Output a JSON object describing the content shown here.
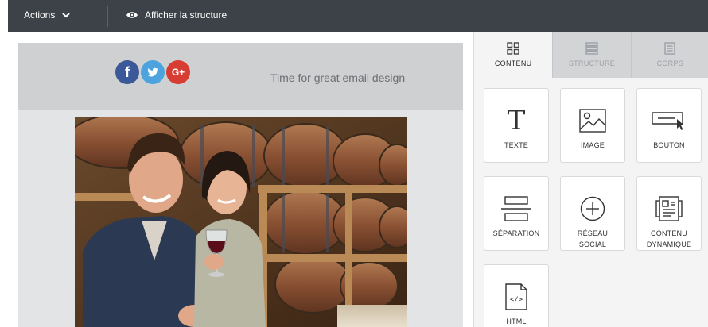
{
  "topbar": {
    "actions_label": "Actions",
    "preview_label": "Afficher la structure"
  },
  "email": {
    "header_text": "Time for great email design",
    "social_icons": [
      "facebook-icon",
      "twitter-icon",
      "google-plus-icon"
    ],
    "facebook_glyph": "f",
    "google_glyph": "G+"
  },
  "panel": {
    "tabs": [
      {
        "label": "CONTENU",
        "active": true
      },
      {
        "label": "STRUCTURE",
        "active": false
      },
      {
        "label": "CORPS",
        "active": false
      }
    ],
    "blocks": [
      {
        "label": "TEXTE",
        "icon": "text-icon"
      },
      {
        "label": "IMAGE",
        "icon": "image-icon"
      },
      {
        "label": "BOUTON",
        "icon": "button-icon"
      },
      {
        "label": "SÉPARATION",
        "icon": "separator-icon"
      },
      {
        "label": "RÉSEAU SOCIAL",
        "icon": "social-network-icon"
      },
      {
        "label": "CONTENU DYNAMIQUE",
        "icon": "dynamic-content-icon"
      },
      {
        "label": "HTML",
        "icon": "html-icon"
      }
    ]
  },
  "colors": {
    "topbar": "#3c4247",
    "panel_bg": "#f4f4f4",
    "facebook": "#3b5998",
    "twitter": "#4ca3dd",
    "google": "#d73d32"
  }
}
